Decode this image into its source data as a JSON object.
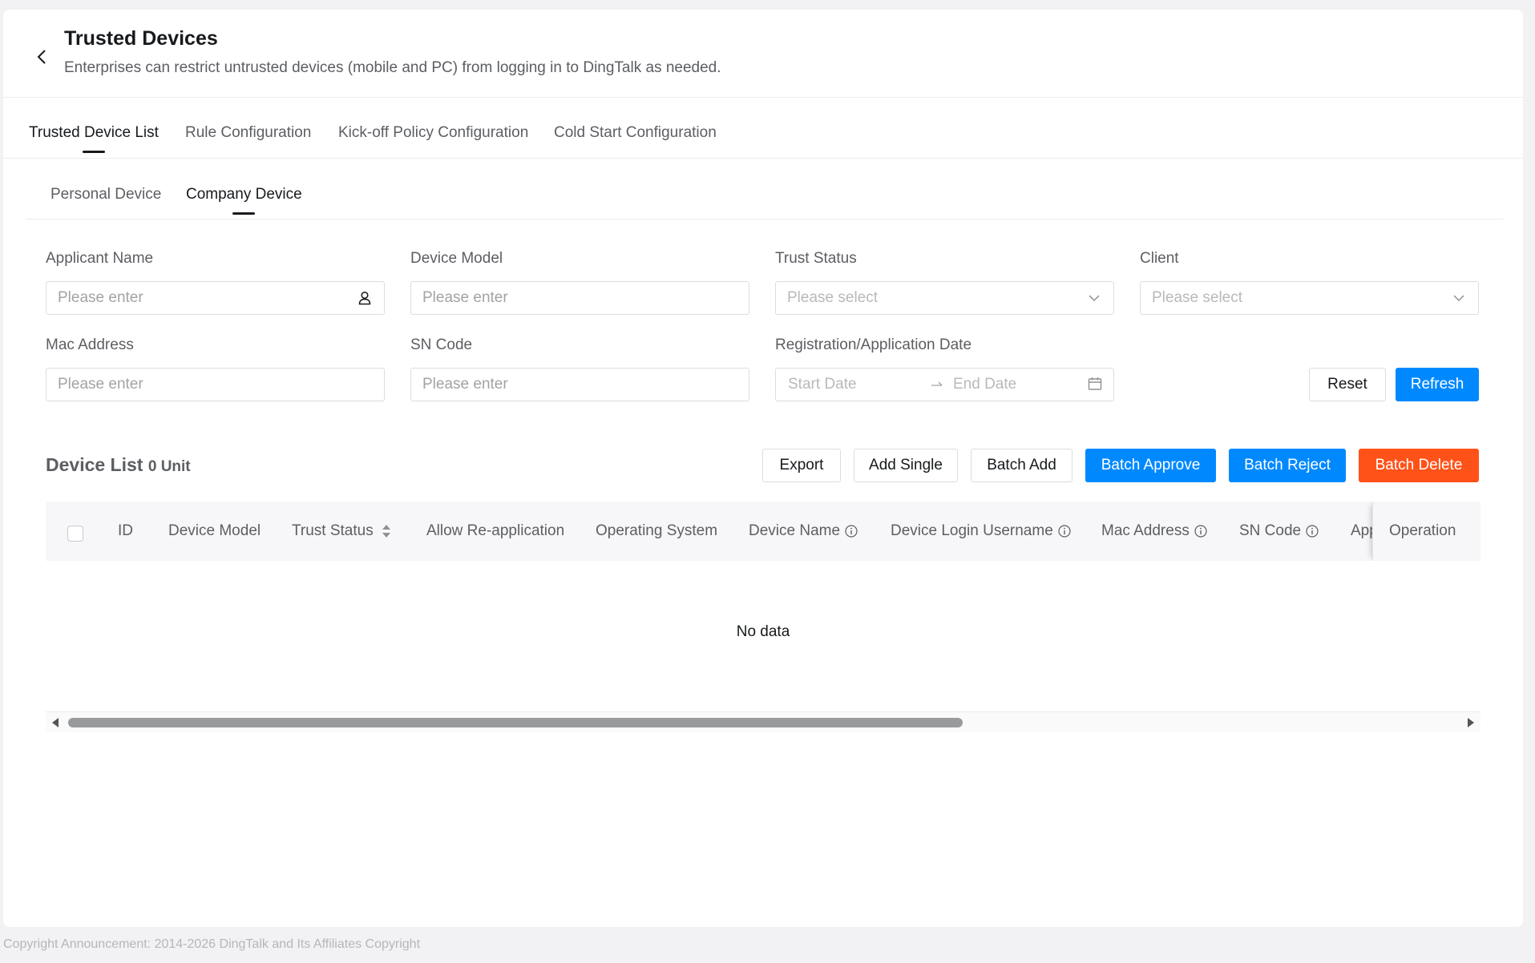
{
  "header": {
    "title": "Trusted Devices",
    "subtitle": "Enterprises can restrict untrusted devices (mobile and PC) from logging in to DingTalk as needed."
  },
  "tabs": [
    {
      "label": "Trusted Device List",
      "active": true
    },
    {
      "label": "Rule Configuration",
      "active": false
    },
    {
      "label": "Kick-off Policy Configuration",
      "active": false
    },
    {
      "label": "Cold Start Configuration",
      "active": false
    }
  ],
  "subtabs": [
    {
      "label": "Personal Device",
      "active": false
    },
    {
      "label": "Company Device",
      "active": true
    }
  ],
  "filters": {
    "applicant_name": {
      "label": "Applicant Name",
      "placeholder": "Please enter",
      "value": ""
    },
    "device_model": {
      "label": "Device Model",
      "placeholder": "Please enter",
      "value": ""
    },
    "trust_status": {
      "label": "Trust Status",
      "placeholder": "Please select"
    },
    "client": {
      "label": "Client",
      "placeholder": "Please select"
    },
    "mac_address": {
      "label": "Mac Address",
      "placeholder": "Please enter",
      "value": ""
    },
    "sn_code": {
      "label": "SN Code",
      "placeholder": "Please enter",
      "value": ""
    },
    "date_range": {
      "label": "Registration/Application Date",
      "start_placeholder": "Start Date",
      "end_placeholder": "End Date"
    },
    "reset_label": "Reset",
    "refresh_label": "Refresh"
  },
  "device_list": {
    "title": "Device List",
    "count": "0 Unit",
    "actions": {
      "export": "Export",
      "add_single": "Add Single",
      "batch_add": "Batch Add",
      "batch_approve": "Batch Approve",
      "batch_reject": "Batch Reject",
      "batch_delete": "Batch Delete"
    },
    "columns": {
      "id": "ID",
      "device_model": "Device Model",
      "trust_status": "Trust Status",
      "allow_reapplication": "Allow Re-application",
      "operating_system": "Operating System",
      "device_name": "Device Name",
      "device_login_username": "Device Login Username",
      "mac_address": "Mac Address",
      "sn_code": "SN Code",
      "app_truncated": "App",
      "operation": "Operation"
    },
    "rows": [],
    "empty_text": "No data"
  },
  "icons": {
    "back": "chevron-left-icon",
    "person": "person-icon",
    "dropdown": "chevron-down-icon",
    "calendar": "calendar-icon",
    "sort": "sort-icon",
    "info": "info-icon",
    "range_arrow": "arrow-right-icon"
  },
  "colors": {
    "primary": "#0089ff",
    "danger": "#ff5219",
    "text": "#171a1d",
    "secondary_text": "#5c5e62"
  },
  "footer": {
    "copyright": "Copyright Announcement: 2014-2026 DingTalk and Its Affiliates Copyright"
  }
}
